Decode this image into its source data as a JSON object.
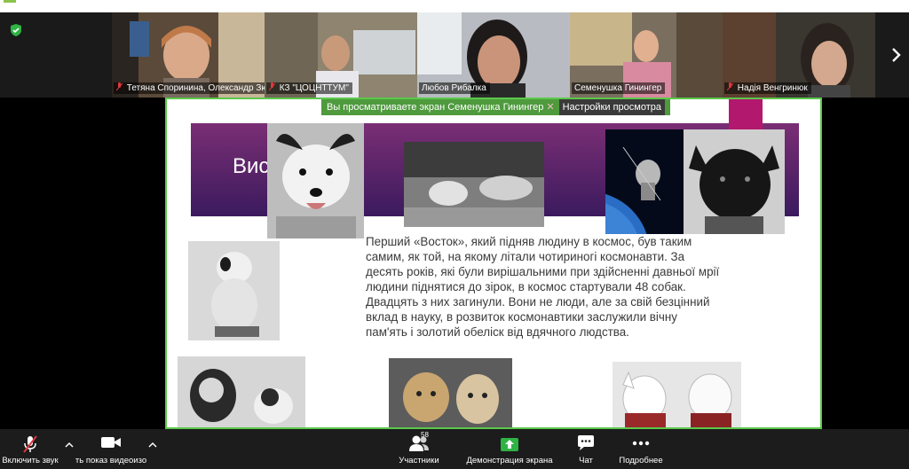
{
  "gallery": {
    "participants": [
      {
        "name": "Тетяна Споринина, Олександр Зю...",
        "muted": true
      },
      {
        "name": "КЗ \"ЦОЦНТТУМ\"",
        "muted": true
      },
      {
        "name": "Любов Рибалка",
        "muted": false
      },
      {
        "name": "Семенушка Гинингер",
        "muted": false
      },
      {
        "name": "Надія Венгринюк",
        "muted": true
      }
    ]
  },
  "share": {
    "banner_text": "Вы просматриваете экран Семенушка Гинингер",
    "view_options_label": "Настройки просмотра",
    "slide": {
      "title_partial": "Вис",
      "paragraph": "Перший «Восток», який підняв людину в космос, був таким самим, як той, на якому літали чотириногі космонавти. За десять років, які були вирішальними при здійсненні давньої мрії людини піднятися до зірок, в космос стартували 48 собак. Двадцять з них загинули. Вони не люди, але за свій безцінний вклад в науку, в розвиток космонавтики заслужили вічну пам'ять і золотий обеліск від вдячного людства."
    }
  },
  "toolbar": {
    "unmute_label": "Включить звук",
    "video_label": "ть показ видеоизо",
    "participants_label": "Участники",
    "participants_count": "58",
    "share_label": "Демонстрация экрана",
    "chat_label": "Чат",
    "more_label": "Подробнее"
  },
  "colors": {
    "share_border": "#5ac94a",
    "banner": "#4e9a3d",
    "slide_purple": "#5a2468",
    "slide_magenta": "#b2186e",
    "share_icon": "#2fb344",
    "muted_mic": "#e0383e"
  }
}
